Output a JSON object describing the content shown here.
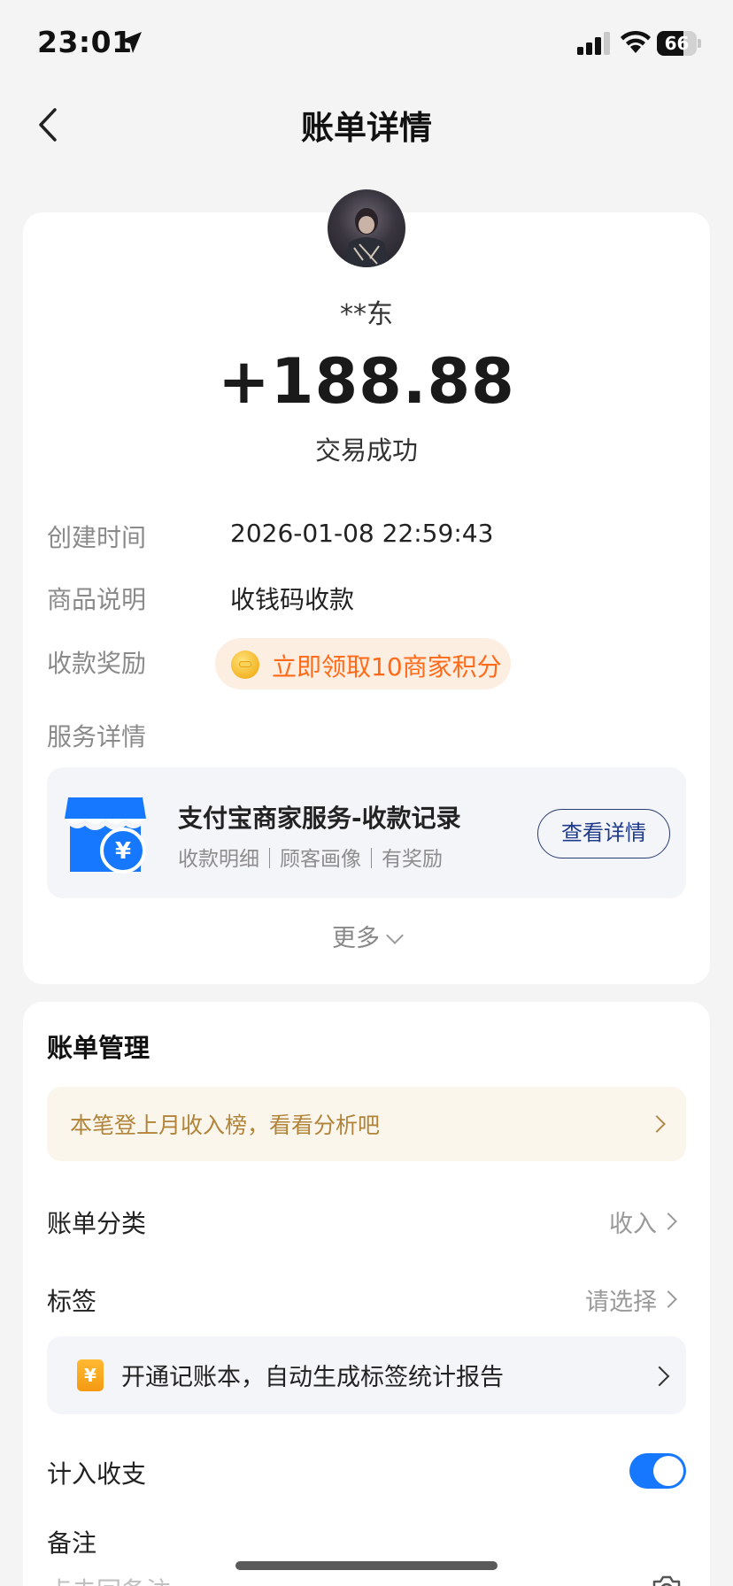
{
  "status_bar": {
    "time": "23:01",
    "battery": "66",
    "battery_level": 0.66
  },
  "nav": {
    "title": "账单详情"
  },
  "transaction": {
    "payer_name": "**东",
    "amount": "+188.88",
    "status": "交易成功"
  },
  "details": {
    "created_time_label": "创建时间",
    "created_time_value": "2026-01-08 22:59:43",
    "product_label": "商品说明",
    "product_value": "收钱码收款",
    "reward_label": "收款奖励",
    "reward_button": "立即领取10商家积分",
    "service_label": "服务详情"
  },
  "service_card": {
    "title": "支付宝商家服务-收款记录",
    "subtitle": "收款明细｜顾客画像｜有奖励",
    "button": "查看详情"
  },
  "more": {
    "label": "更多"
  },
  "manage": {
    "title": "账单管理",
    "tip": "本笔登上月收入榜，看看分析吧",
    "category_label": "账单分类",
    "category_value": "收入",
    "tag_label": "标签",
    "tag_value": "请选择",
    "ledger_icon": "¥",
    "ledger_promo": "开通记账本，自动生成标签统计报告",
    "include_label": "计入收支",
    "include_on": true,
    "note_label": "备注",
    "note_placeholder": "点击回备注"
  },
  "colors": {
    "accent_blue": "#1677ff",
    "reward_orange": "#ff6a19",
    "tip_gold": "#b1843a"
  }
}
